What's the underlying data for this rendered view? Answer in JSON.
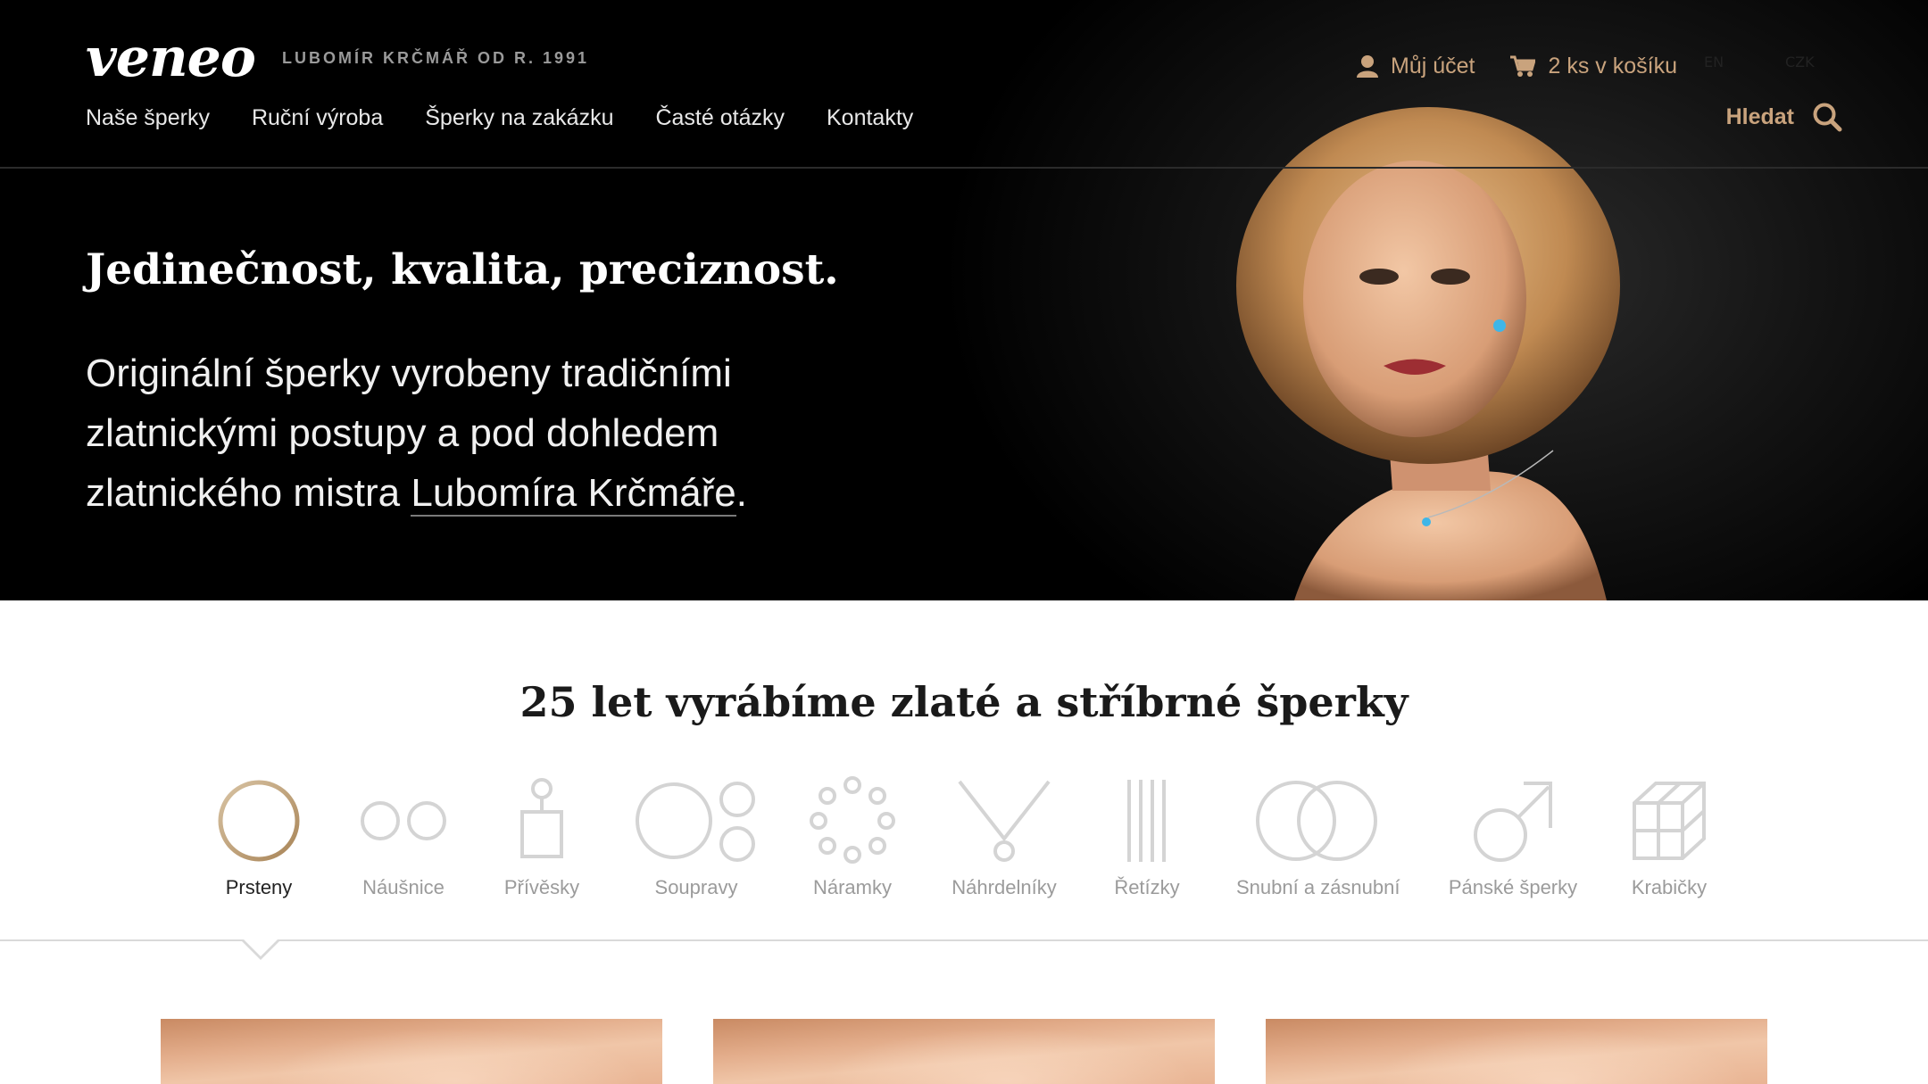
{
  "brand": {
    "logo": "veneo",
    "tagline": "LUBOMÍR KRČMÁŘ OD R. 1991"
  },
  "topnav": {
    "account": "Můj účet",
    "cart": "2 ks v košíku",
    "language": "EN",
    "currency": "CZK"
  },
  "mainnav": [
    "Naše šperky",
    "Ruční výroba",
    "Šperky na zakázku",
    "Časté otázky",
    "Kontakty"
  ],
  "search": {
    "label": "Hledat"
  },
  "hero": {
    "title": "Jedinečnost, kvalita, preciznost.",
    "text_before": "Originální šperky vyrobeny tradičními zlatnickými postupy a pod dohledem zlatnického mistra ",
    "text_link": "Lubomíra Krčmáře",
    "text_after": "."
  },
  "section": {
    "title": "25 let vyrábíme zlaté a stříbrné šperky"
  },
  "categories": [
    {
      "label": "Prsteny",
      "icon": "ring-icon",
      "active": true
    },
    {
      "label": "Náušnice",
      "icon": "earrings-icon",
      "active": false
    },
    {
      "label": "Přívěsky",
      "icon": "pendant-icon",
      "active": false
    },
    {
      "label": "Soupravy",
      "icon": "set-icon",
      "active": false
    },
    {
      "label": "Náramky",
      "icon": "bracelet-icon",
      "active": false
    },
    {
      "label": "Náhrdelníky",
      "icon": "necklace-icon",
      "active": false
    },
    {
      "label": "Řetízky",
      "icon": "chain-icon",
      "active": false
    },
    {
      "label": "Snubní a zásnubní",
      "icon": "wedding-rings-icon",
      "active": false
    },
    {
      "label": "Pánské šperky",
      "icon": "mens-jewelry-icon",
      "active": false
    },
    {
      "label": "Krabičky",
      "icon": "box-icon",
      "active": false
    }
  ],
  "colors": {
    "accent": "#c9a37d",
    "icon_gray": "#d4d4d4",
    "background_dark": "#000000"
  }
}
